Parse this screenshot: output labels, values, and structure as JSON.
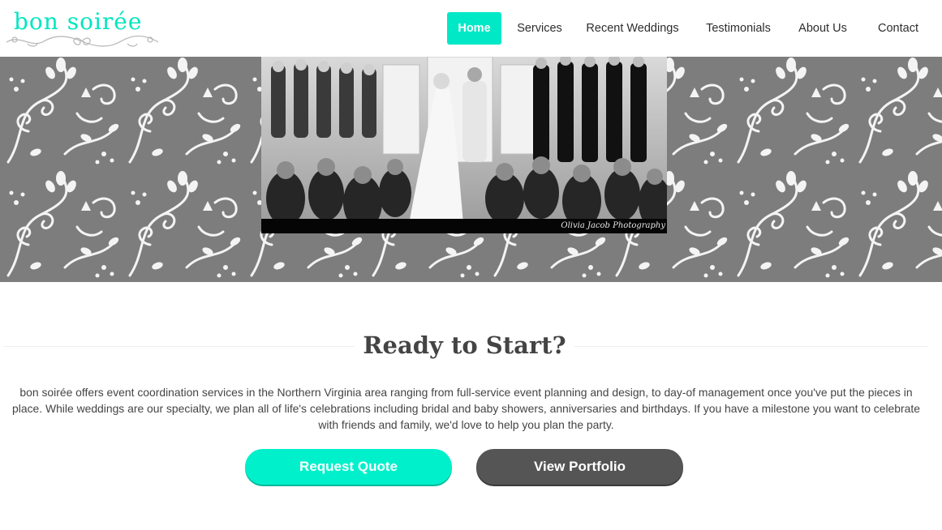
{
  "brand": {
    "name": "bon soirée",
    "accent_color": "#00e8c6",
    "logo_icon": "flourish-ornament"
  },
  "nav": {
    "items": [
      {
        "label": "Home",
        "active": true
      },
      {
        "label": "Services",
        "active": false
      },
      {
        "label": "Recent Weddings",
        "active": false
      },
      {
        "label": "Testimonials",
        "active": false
      },
      {
        "label": "About Us",
        "active": false
      },
      {
        "label": "Contact",
        "active": false
      }
    ]
  },
  "hero": {
    "photo_credit": "Olivia Jacob Photography",
    "background_color": "#7d7d7d"
  },
  "intro": {
    "title": "Ready to Start?",
    "body": "bon soirée offers event coordination services in the Northern Virginia area ranging from full-service event planning and design, to day-of management once you've put the pieces in place. While weddings are our specialty, we plan all of life's celebrations including bridal and baby showers, anniversaries and birthdays. If you have a milestone you want to celebrate with friends and family, we'd love to help you plan the party."
  },
  "actions": {
    "request_quote": "Request Quote",
    "view_portfolio": "View Portfolio",
    "quote_color": "#00f0cb",
    "portfolio_color": "#555555"
  }
}
